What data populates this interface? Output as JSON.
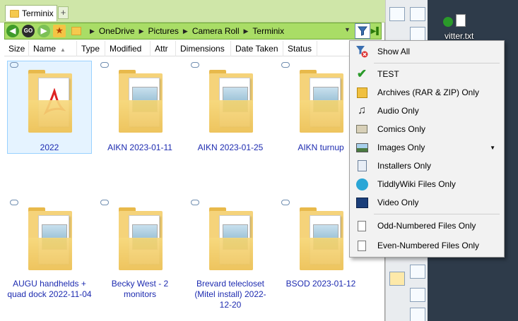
{
  "window": {
    "tab_label": "Terminix",
    "tab_add": "+"
  },
  "address": {
    "nav_go": "GO",
    "crumbs": [
      "OneDrive",
      "Pictures",
      "Camera Roll",
      "Terminix"
    ]
  },
  "columns": [
    "Size",
    "Name",
    "Type",
    "Modified",
    "Attr",
    "Dimensions",
    "Date Taken",
    "Status"
  ],
  "items": [
    {
      "label": "2022",
      "kind": "pdf"
    },
    {
      "label": "AIKN 2023-01-11",
      "kind": "pic"
    },
    {
      "label": "AIKN 2023-01-25",
      "kind": "pic"
    },
    {
      "label": "AIKN turnup",
      "kind": "pic"
    },
    {
      "label": "AUGU handhelds + quad dock 2022-11-04",
      "kind": "pic"
    },
    {
      "label": "Becky West - 2 monitors",
      "kind": "pic"
    },
    {
      "label": "Brevard telecloset (Mitel install) 2022-12-20",
      "kind": "pic"
    },
    {
      "label": "BSOD 2023-01-12",
      "kind": "pic"
    }
  ],
  "menu": {
    "items": [
      {
        "label": "Show All",
        "icon": "filter-clear-icon"
      },
      {
        "label": "TEST",
        "icon": "checkmark-icon"
      },
      {
        "label": "Archives (RAR & ZIP) Only",
        "icon": "archive-icon"
      },
      {
        "label": "Audio Only",
        "icon": "audio-icon"
      },
      {
        "label": "Comics Only",
        "icon": "comics-icon"
      },
      {
        "label": "Images Only",
        "icon": "image-icon",
        "submenu": true
      },
      {
        "label": "Installers Only",
        "icon": "installer-icon"
      },
      {
        "label": "TiddlyWiki Files Only",
        "icon": "tiddlywiki-icon"
      },
      {
        "label": "Video Only",
        "icon": "video-icon"
      },
      {
        "label": "Odd-Numbered Files Only",
        "icon": "file-icon"
      },
      {
        "label": "Even-Numbered Files Only",
        "icon": "file-icon"
      }
    ]
  },
  "desktop": {
    "file_label": "vitter.txt"
  },
  "colors": {
    "accent_green": "#a9dd66",
    "link_blue": "#1d2bb0",
    "selection": "#e5f3ff"
  }
}
